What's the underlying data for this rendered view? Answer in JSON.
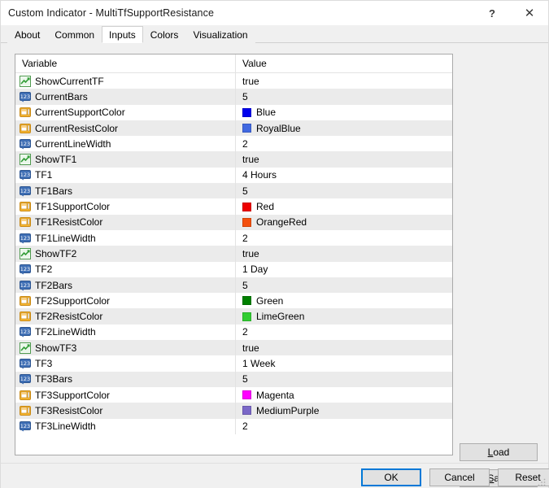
{
  "window": {
    "title": "Custom Indicator - MultiTfSupportResistance",
    "help_glyph": "?",
    "close_glyph": "✕"
  },
  "tabs": [
    {
      "label": "About",
      "active": false
    },
    {
      "label": "Common",
      "active": false
    },
    {
      "label": "Inputs",
      "active": true
    },
    {
      "label": "Colors",
      "active": false
    },
    {
      "label": "Visualization",
      "active": false
    }
  ],
  "grid": {
    "columns": {
      "variable": "Variable",
      "value": "Value"
    },
    "rows": [
      {
        "icon": "bool-icon",
        "type": "bool",
        "variable": "ShowCurrentTF",
        "value": "true"
      },
      {
        "icon": "number-icon",
        "type": "int",
        "variable": "CurrentBars",
        "value": "5"
      },
      {
        "icon": "color-icon",
        "type": "color",
        "variable": "CurrentSupportColor",
        "value": "Blue",
        "swatch": "#0000ee"
      },
      {
        "icon": "color-icon",
        "type": "color",
        "variable": "CurrentResistColor",
        "value": "RoyalBlue",
        "swatch": "#4169e1"
      },
      {
        "icon": "number-icon",
        "type": "int",
        "variable": "CurrentLineWidth",
        "value": "2"
      },
      {
        "icon": "bool-icon",
        "type": "bool",
        "variable": "ShowTF1",
        "value": "true"
      },
      {
        "icon": "number-icon",
        "type": "int",
        "variable": "TF1",
        "value": "4 Hours"
      },
      {
        "icon": "number-icon",
        "type": "int",
        "variable": "TF1Bars",
        "value": "5"
      },
      {
        "icon": "color-icon",
        "type": "color",
        "variable": "TF1SupportColor",
        "value": "Red",
        "swatch": "#ee0000"
      },
      {
        "icon": "color-icon",
        "type": "color",
        "variable": "TF1ResistColor",
        "value": "OrangeRed",
        "swatch": "#f4500e"
      },
      {
        "icon": "number-icon",
        "type": "int",
        "variable": "TF1LineWidth",
        "value": "2"
      },
      {
        "icon": "bool-icon",
        "type": "bool",
        "variable": "ShowTF2",
        "value": "true"
      },
      {
        "icon": "number-icon",
        "type": "int",
        "variable": "TF2",
        "value": "1 Day"
      },
      {
        "icon": "number-icon",
        "type": "int",
        "variable": "TF2Bars",
        "value": "5"
      },
      {
        "icon": "color-icon",
        "type": "color",
        "variable": "TF2SupportColor",
        "value": "Green",
        "swatch": "#008000"
      },
      {
        "icon": "color-icon",
        "type": "color",
        "variable": "TF2ResistColor",
        "value": "LimeGreen",
        "swatch": "#32cd32"
      },
      {
        "icon": "number-icon",
        "type": "int",
        "variable": "TF2LineWidth",
        "value": "2"
      },
      {
        "icon": "bool-icon",
        "type": "bool",
        "variable": "ShowTF3",
        "value": "true"
      },
      {
        "icon": "number-icon",
        "type": "int",
        "variable": "TF3",
        "value": "1 Week"
      },
      {
        "icon": "number-icon",
        "type": "int",
        "variable": "TF3Bars",
        "value": "5"
      },
      {
        "icon": "color-icon",
        "type": "color",
        "variable": "TF3SupportColor",
        "value": "Magenta",
        "swatch": "#ff00ff"
      },
      {
        "icon": "color-icon",
        "type": "color",
        "variable": "TF3ResistColor",
        "value": "MediumPurple",
        "swatch": "#7b68c8"
      },
      {
        "icon": "number-icon",
        "type": "int",
        "variable": "TF3LineWidth",
        "value": "2"
      }
    ]
  },
  "side_buttons": {
    "load": {
      "mnemonic": "L",
      "rest": "oad"
    },
    "save": {
      "mnemonic": "S",
      "rest": "ave"
    }
  },
  "bottom_buttons": [
    {
      "label": "OK",
      "default": true
    },
    {
      "label": "Cancel",
      "default": false
    },
    {
      "label": "Reset",
      "default": false
    }
  ],
  "colors": {
    "accent": "#0078d7",
    "window_bg": "#f0f0f0",
    "grid_bg": "#ffffff",
    "grid_alt_row": "#ebebeb"
  }
}
